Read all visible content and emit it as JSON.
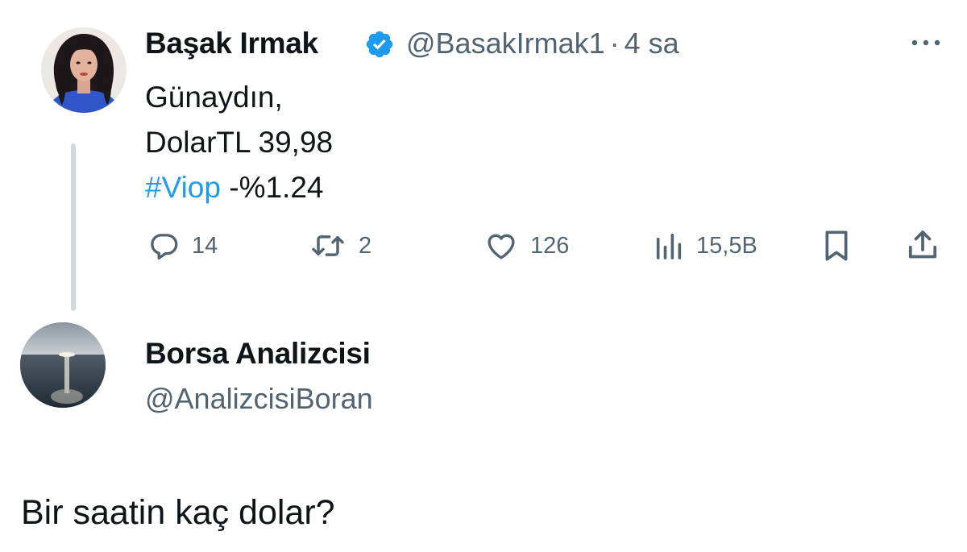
{
  "tweet": {
    "author_name": "Başak Irmak",
    "author_handle": "@BasakIrmak1",
    "separator": "·",
    "time": "4 sa",
    "verified": true,
    "more_icon": "ellipsis-icon",
    "lines": {
      "greeting": "Günaydın,",
      "dollar": "DolarTL 39,98",
      "hashtag": "#Viop",
      "hashtag_value": " -%1.24"
    },
    "actions": {
      "replies": "14",
      "retweets": "2",
      "likes": "126",
      "views": "15,5B"
    },
    "colors": {
      "link": "#1d9bf0",
      "muted": "#536471",
      "verified": "#1d9bf0"
    }
  },
  "reply_author": {
    "name": "Borsa Analizcisi",
    "handle": "@AnalizcisiBoran"
  },
  "reply_text": "Bir saatin kaç dolar?"
}
